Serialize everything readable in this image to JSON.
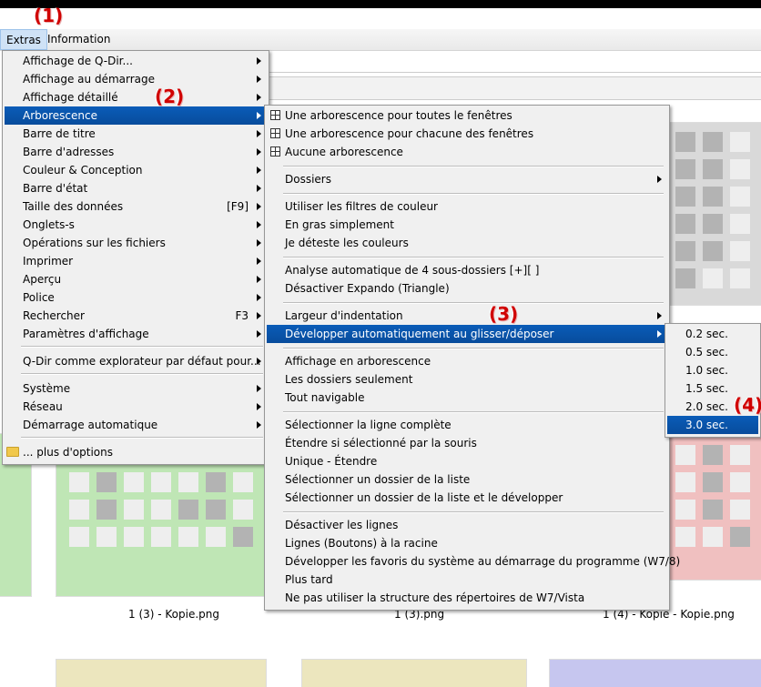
{
  "annotations": [
    "(1)",
    "(2)",
    "(3)",
    "(4)"
  ],
  "menubar": {
    "items": [
      "Extras",
      "Information"
    ]
  },
  "main_menu": {
    "items": [
      {
        "label": "Affichage de Q-Dir...",
        "submenu": true
      },
      {
        "label": "Affichage au démarrage",
        "submenu": true
      },
      {
        "label": "Affichage détaillé",
        "submenu": true
      },
      {
        "label": "Arborescence",
        "submenu": true,
        "selected": true
      },
      {
        "label": "Barre de titre",
        "submenu": true
      },
      {
        "label": "Barre d'adresses",
        "submenu": true
      },
      {
        "label": "Couleur & Conception",
        "submenu": true
      },
      {
        "label": "Barre d'état",
        "submenu": true
      },
      {
        "label": "Taille des données",
        "shortcut": "[F9]",
        "submenu": true
      },
      {
        "label": "Onglets-s",
        "submenu": true
      },
      {
        "label": "Opérations sur les fichiers",
        "submenu": true
      },
      {
        "label": "Imprimer",
        "submenu": true
      },
      {
        "label": "Aperçu",
        "submenu": true
      },
      {
        "label": "Police",
        "submenu": true
      },
      {
        "label": "Rechercher",
        "shortcut": "F3",
        "submenu": true
      },
      {
        "label": "Paramètres d'affichage",
        "submenu": true
      },
      {
        "label": "Q-Dir comme explorateur par défaut pour...",
        "submenu": true
      },
      {
        "label": "Système",
        "submenu": true
      },
      {
        "label": "Réseau",
        "submenu": true
      },
      {
        "label": "Démarrage automatique",
        "submenu": true
      },
      {
        "label": "... plus d'options",
        "icon": "folder-icon"
      }
    ]
  },
  "tree_menu": {
    "items": [
      {
        "label": "Une arborescence pour toutes le fenêtres",
        "icon": "grid-icon"
      },
      {
        "label": "Une arborescence pour chacune des fenêtres",
        "icon": "grid-icon"
      },
      {
        "label": "Aucune arborescence",
        "icon": "grid-icon"
      },
      {
        "label": "Dossiers",
        "submenu": true
      },
      {
        "label": "Utiliser les filtres de couleur"
      },
      {
        "label": "En gras simplement"
      },
      {
        "label": "Je déteste les couleurs"
      },
      {
        "label": "Analyse automatique de 4 sous-dossiers [+][ ]"
      },
      {
        "label": "Désactiver Expando (Triangle)"
      },
      {
        "label": "Largeur d'indentation",
        "submenu": true
      },
      {
        "label": "Développer automatiquement au glisser/déposer",
        "submenu": true,
        "selected": true
      },
      {
        "label": "Affichage en arborescence"
      },
      {
        "label": "Les dossiers seulement"
      },
      {
        "label": "Tout navigable"
      },
      {
        "label": "Sélectionner la ligne complète"
      },
      {
        "label": "Étendre si sélectionné par la souris"
      },
      {
        "label": "Unique - Étendre"
      },
      {
        "label": "Sélectionner un dossier de la liste"
      },
      {
        "label": "Sélectionner un dossier de la liste et le développer"
      },
      {
        "label": "Désactiver les lignes"
      },
      {
        "label": "Lignes (Boutons) à la racine"
      },
      {
        "label": "Développer les favoris du système au démarrage du programme (W7/8)"
      },
      {
        "label": "Plus tard"
      },
      {
        "label": "Ne pas utiliser la structure des répertoires de W7/Vista"
      }
    ]
  },
  "delay_menu": {
    "items": [
      {
        "label": "0.2 sec."
      },
      {
        "label": "0.5 sec."
      },
      {
        "label": "1.0 sec."
      },
      {
        "label": "1.5 sec."
      },
      {
        "label": "2.0 sec."
      },
      {
        "label": "3.0 sec.",
        "selected": true
      }
    ]
  },
  "thumbnails": {
    "labels": [
      "1 (3) - Kopie.png",
      "1 (3).png",
      "1 (4) - Kopie - Kopie.png"
    ],
    "colors": {
      "green_bg": "#bfe6b5",
      "gray_bg": "#d9d9d9",
      "red_bg": "#f0c0c0",
      "yellow_bg": "#ece6be",
      "blue_bg": "#c6c6ef",
      "dark_cell": "#b3b3b3",
      "light_cell": "#eeeeee"
    }
  },
  "colors": {
    "selection": "#0a5cb8",
    "annotation": "#d00000"
  }
}
